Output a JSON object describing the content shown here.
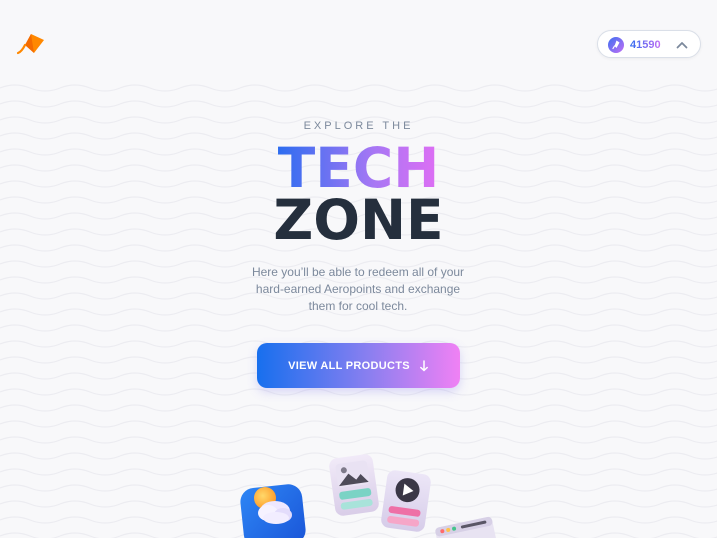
{
  "header": {
    "logo_icon": "kite-logo-icon",
    "points": {
      "value": "41590",
      "coin_icon": "aeropoint-coin-icon",
      "toggle_icon": "chevron-up-icon"
    }
  },
  "hero": {
    "eyebrow": "EXPLORE THE",
    "title_line1": "TECH",
    "title_line2": "ZONE",
    "description": "Here you’ll be able to redeem all of your hard-earned Aeropoints and exchange them for cool tech.",
    "cta_label": "VIEW ALL PRODUCTS",
    "cta_icon": "arrow-down-icon"
  },
  "illustrations": [
    "weather-app-icon",
    "gallery-app-icon",
    "video-app-icon",
    "browser-window-icon"
  ],
  "colors": {
    "background": "#f8f8fa",
    "accent_blue": "#176fee",
    "accent_pink": "#f081f4",
    "logo_orange": "#ff8800",
    "heading_dark": "#252f3d",
    "muted_text": "#7c899c"
  }
}
